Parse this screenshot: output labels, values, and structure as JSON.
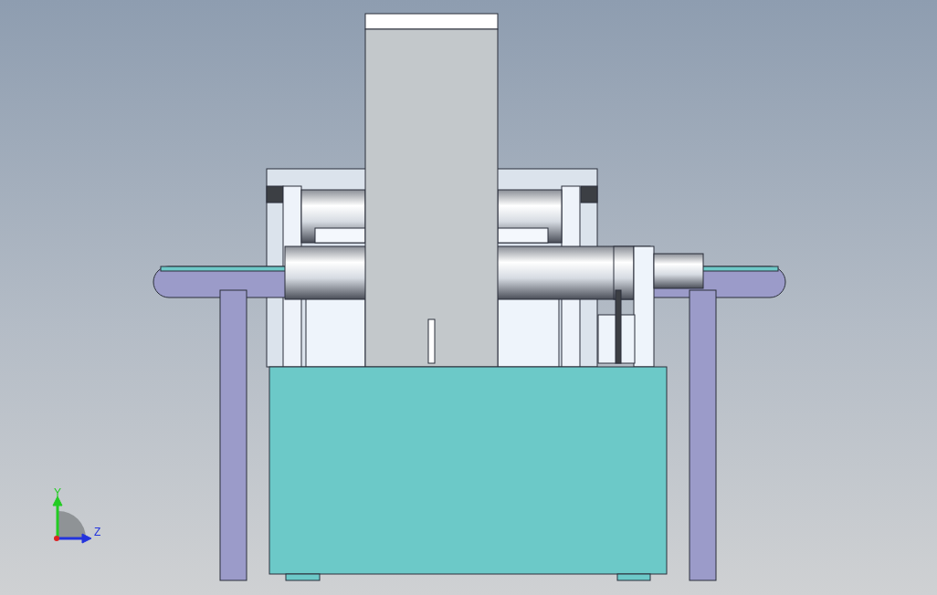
{
  "viewport": {
    "triad": [
      {
        "kind": "vertical",
        "label": "Y",
        "color": "#22cc22"
      },
      {
        "kind": "horizontal",
        "label": "Z",
        "color": "#2233dd"
      }
    ]
  }
}
